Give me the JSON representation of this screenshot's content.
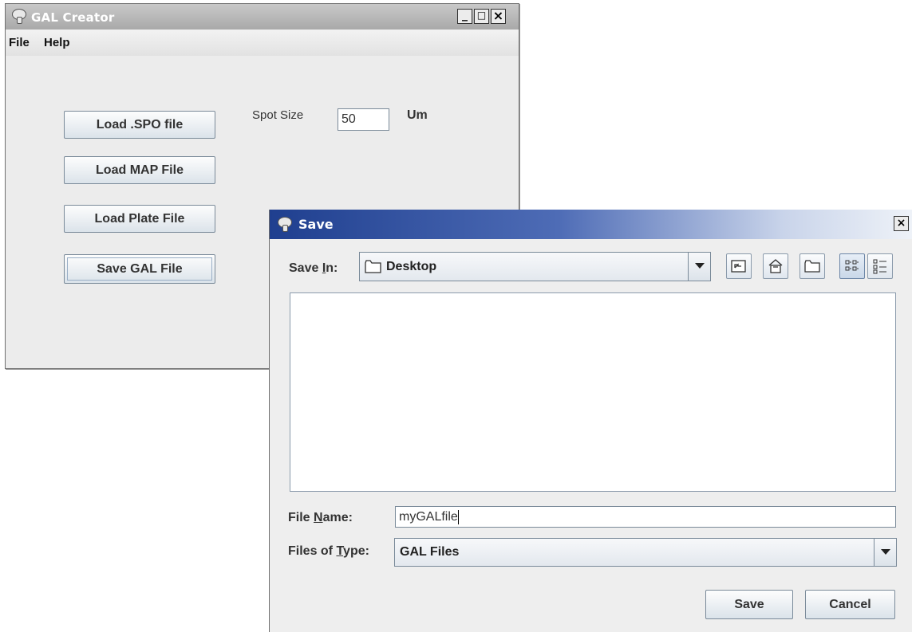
{
  "gal_window": {
    "title": "GAL Creator",
    "window_controls": {
      "minimize": "_",
      "maximize": "□",
      "close": "×"
    },
    "menu": [
      "File",
      "Help"
    ],
    "buttons": {
      "load_spo": "Load .SPO file",
      "load_map": "Load MAP File",
      "load_plate": "Load Plate File",
      "save_gal": "Save GAL File"
    },
    "spot_size": {
      "label": "Spot Size",
      "value": "50",
      "unit": "Um"
    }
  },
  "save_dialog": {
    "title": "Save",
    "close": "×",
    "save_in": {
      "label_pre": "Save ",
      "label_mnemonic": "I",
      "label_post": "n:",
      "value": "Desktop"
    },
    "toolbar_icons": [
      "up-one-level-icon",
      "home-icon",
      "new-folder-icon",
      "list-view-icon",
      "details-view-icon"
    ],
    "file_name": {
      "label_pre": "File ",
      "label_mnemonic": "N",
      "label_post": "ame:",
      "value": "myGALfile"
    },
    "files_of_type": {
      "label_pre": "Files of ",
      "label_mnemonic": "T",
      "label_post": "ype:",
      "value": "GAL Files"
    },
    "buttons": {
      "save": "Save",
      "cancel": "Cancel"
    }
  },
  "colors": {
    "window_bg": "#ececec",
    "dialog_title_start": "#1f3f8f",
    "button_text": "#333333"
  }
}
